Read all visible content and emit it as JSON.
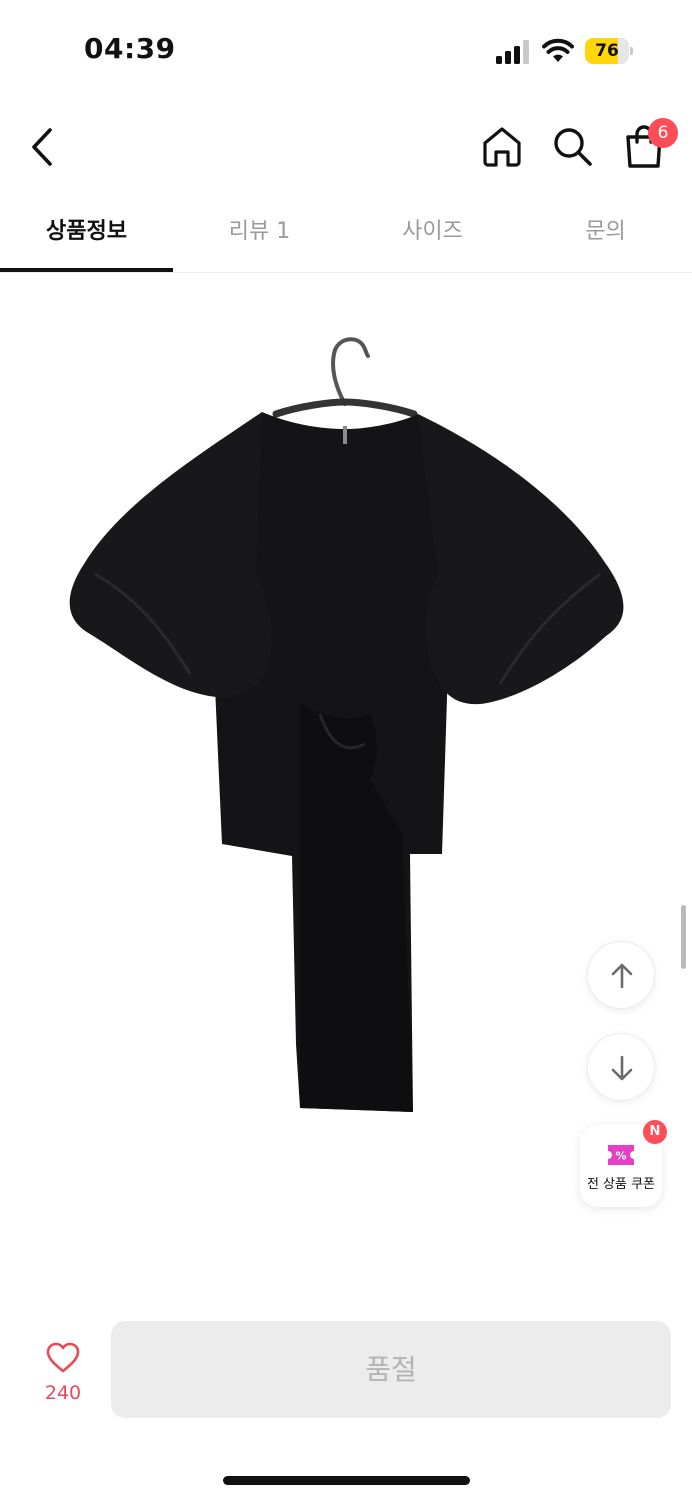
{
  "status_bar": {
    "time": "04:39",
    "battery_level": "76",
    "battery_percent": 76,
    "battery_color": "#ffd60a"
  },
  "header": {
    "back_icon": "chevron-left-icon",
    "home_icon": "home-icon",
    "search_icon": "search-icon",
    "cart_icon": "shopping-bag-icon",
    "cart_count": "6",
    "badge_color": "#ff4d57"
  },
  "tabs": [
    {
      "label": "상품정보",
      "active": true
    },
    {
      "label": "리뷰 1",
      "active": false
    },
    {
      "label": "사이즈",
      "active": false
    },
    {
      "label": "문의",
      "active": false
    }
  ],
  "floating": {
    "scroll_up_icon": "arrow-up-icon",
    "scroll_down_icon": "arrow-down-icon",
    "coupon_label": "전 상품 쿠폰",
    "coupon_badge": "N",
    "coupon_icon": "coupon-ticket-icon",
    "coupon_color": "#e53fc6"
  },
  "bottom_bar": {
    "like_icon": "heart-outline-icon",
    "like_count": "240",
    "like_color": "#e94a57",
    "action_label": "품절"
  }
}
